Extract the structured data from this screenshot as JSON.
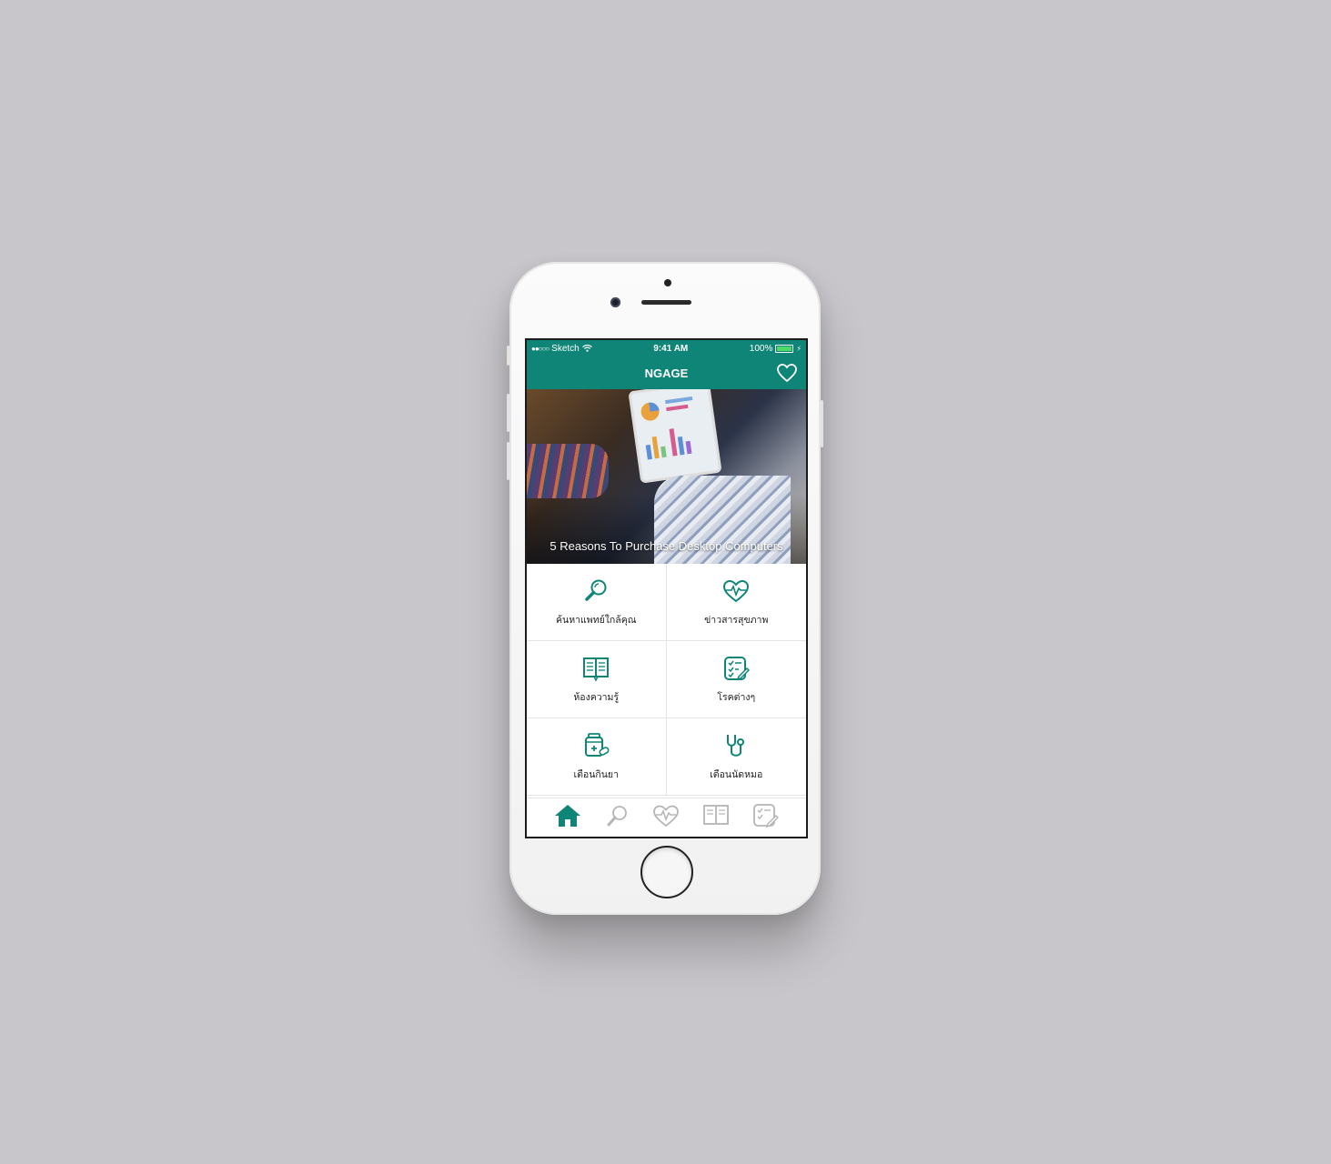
{
  "statusbar": {
    "carrier": "Sketch",
    "time": "9:41 AM",
    "battery": "100%"
  },
  "navbar": {
    "title": "NGAGE"
  },
  "hero": {
    "title": "5 Reasons To Purchase Desktop Computers"
  },
  "menu": {
    "items": [
      {
        "label": "ค้นหาแพทย์ใกล้คุณ",
        "icon": "search-icon"
      },
      {
        "label": "ข่าวสารสุขภาพ",
        "icon": "heartbeat-icon"
      },
      {
        "label": "ห้องความรู้",
        "icon": "book-icon"
      },
      {
        "label": "โรคต่างๆ",
        "icon": "checklist-icon"
      },
      {
        "label": "เตือนกินยา",
        "icon": "medicine-icon"
      },
      {
        "label": "เตือนนัดหมอ",
        "icon": "stethoscope-icon"
      }
    ]
  },
  "tabbar": {
    "tabs": [
      {
        "icon": "home-icon",
        "active": true
      },
      {
        "icon": "search-icon",
        "active": false
      },
      {
        "icon": "heartbeat-icon",
        "active": false
      },
      {
        "icon": "book-icon",
        "active": false
      },
      {
        "icon": "checklist-icon",
        "active": false
      }
    ]
  },
  "colors": {
    "primary": "#0f8577",
    "inactive": "#b5b5b5",
    "background": "#c8c6ca"
  }
}
